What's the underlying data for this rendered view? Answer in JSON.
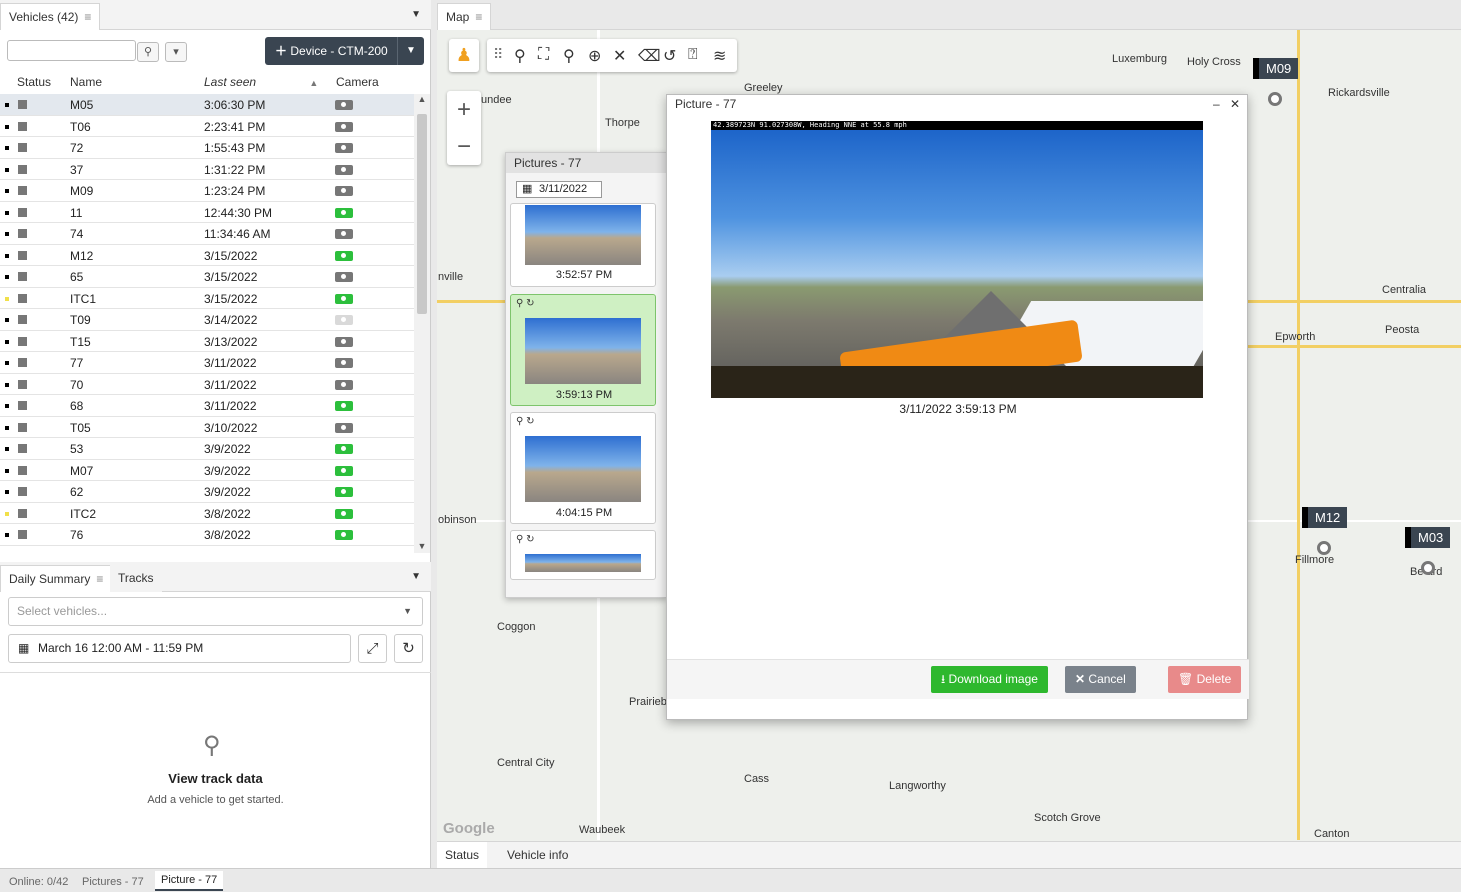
{
  "vehicles_panel": {
    "title": "Vehicles (42)",
    "device_button": "Device - CTM-200",
    "columns": {
      "status": "Status",
      "name": "Name",
      "last_seen": "Last seen",
      "camera": "Camera"
    },
    "rows": [
      {
        "name": "M05",
        "last_seen": "3:06:30 PM",
        "camera": "grey",
        "dot": "black"
      },
      {
        "name": "T06",
        "last_seen": "2:23:41 PM",
        "camera": "grey",
        "dot": "black"
      },
      {
        "name": "72",
        "last_seen": "1:55:43 PM",
        "camera": "grey",
        "dot": "black"
      },
      {
        "name": "37",
        "last_seen": "1:31:22 PM",
        "camera": "grey",
        "dot": "black"
      },
      {
        "name": "M09",
        "last_seen": "1:23:24 PM",
        "camera": "grey",
        "dot": "black"
      },
      {
        "name": "11",
        "last_seen": "12:44:30 PM",
        "camera": "green",
        "dot": "black"
      },
      {
        "name": "74",
        "last_seen": "11:34:46 AM",
        "camera": "grey",
        "dot": "black"
      },
      {
        "name": "M12",
        "last_seen": "3/15/2022",
        "camera": "green",
        "dot": "black"
      },
      {
        "name": "65",
        "last_seen": "3/15/2022",
        "camera": "grey",
        "dot": "black"
      },
      {
        "name": "ITC1",
        "last_seen": "3/15/2022",
        "camera": "green",
        "dot": "yellow"
      },
      {
        "name": "T09",
        "last_seen": "3/14/2022",
        "camera": "light",
        "dot": "black"
      },
      {
        "name": "T15",
        "last_seen": "3/13/2022",
        "camera": "grey",
        "dot": "black"
      },
      {
        "name": "77",
        "last_seen": "3/11/2022",
        "camera": "grey",
        "dot": "black"
      },
      {
        "name": "70",
        "last_seen": "3/11/2022",
        "camera": "grey",
        "dot": "black"
      },
      {
        "name": "68",
        "last_seen": "3/11/2022",
        "camera": "green",
        "dot": "black"
      },
      {
        "name": "T05",
        "last_seen": "3/10/2022",
        "camera": "grey",
        "dot": "black"
      },
      {
        "name": "53",
        "last_seen": "3/9/2022",
        "camera": "green",
        "dot": "black"
      },
      {
        "name": "M07",
        "last_seen": "3/9/2022",
        "camera": "green",
        "dot": "black"
      },
      {
        "name": "62",
        "last_seen": "3/9/2022",
        "camera": "green",
        "dot": "black"
      },
      {
        "name": "ITC2",
        "last_seen": "3/8/2022",
        "camera": "green",
        "dot": "yellow"
      },
      {
        "name": "76",
        "last_seen": "3/8/2022",
        "camera": "green",
        "dot": "black"
      }
    ]
  },
  "summary_panel": {
    "tabs": [
      "Daily Summary",
      "Tracks"
    ],
    "select_placeholder": "Select vehicles...",
    "date_range": "March 16 12:00 AM - 11:59 PM",
    "empty_title": "View track data",
    "empty_subtitle": "Add a vehicle to get started."
  },
  "map_panel": {
    "title": "Map",
    "labels": [
      "Luxemburg",
      "Holy Cross",
      "Greeley",
      "Rickardsville",
      "Thorpe",
      "undee",
      "nville",
      "Centralia",
      "Epworth",
      "Peosta",
      "Fillmore",
      "Be  ard",
      "obinson",
      "Coggon",
      "Prairieb",
      "Central City",
      "Cass",
      "Langworthy",
      "Scotch Grove",
      "Waubeek",
      "Canton",
      "Google"
    ],
    "markers": [
      "M09",
      "M12",
      "M03"
    ],
    "bottom_tabs": [
      "Status",
      "Vehicle info"
    ]
  },
  "pictures_panel": {
    "title": "Pictures - 77",
    "date": "3/11/2022",
    "thumbs": [
      "3:52:57 PM",
      "3:59:13 PM",
      "4:04:15 PM"
    ]
  },
  "picture_window": {
    "title": "Picture - 77",
    "hud": "42.389723N 91.027308W, Heading NNE at 55.8 mph",
    "caption": "3/11/2022 3:59:13 PM",
    "download": "Download image",
    "cancel": "Cancel",
    "delete": "Delete"
  },
  "status_bar": {
    "online": "Online: 0/42",
    "tab1": "Pictures - 77",
    "tab2": "Picture - 77"
  },
  "colors": {
    "accent_dark": "#3a4551",
    "download_green": "#2eb82e",
    "cancel_grey": "#7a828b",
    "delete_red": "#e88a8a"
  }
}
